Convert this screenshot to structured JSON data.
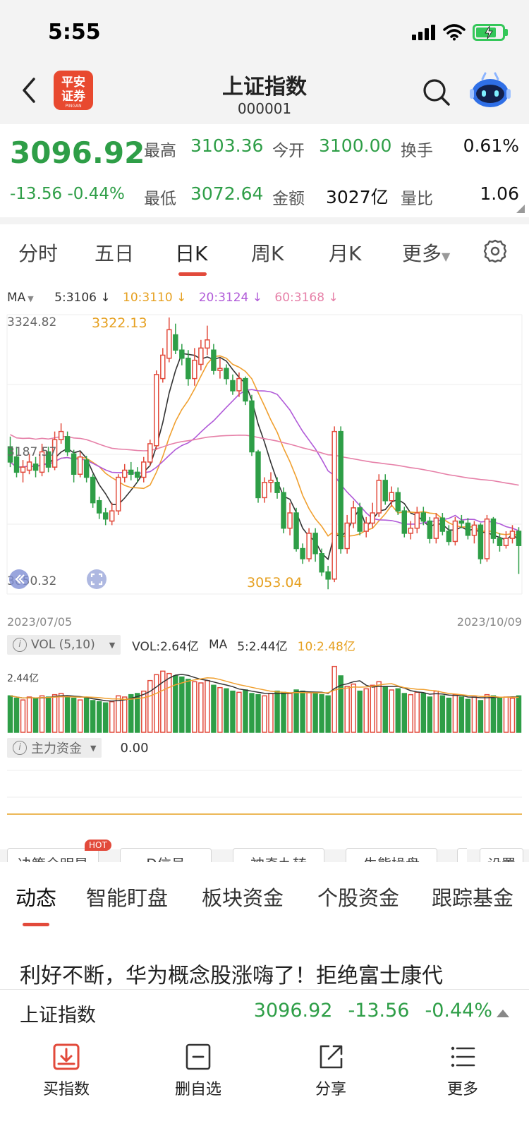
{
  "status_bar": {
    "time": "5:55"
  },
  "header": {
    "title": "上证指数",
    "code": "000001",
    "logo_text": "平安证券",
    "logo_sub": "PINGAN"
  },
  "quote": {
    "price": "3096.92",
    "change": "-13.56",
    "change_pct": "-0.44%",
    "high_label": "最高",
    "high": "3103.36",
    "open_label": "今开",
    "open": "3100.00",
    "turnover_label": "换手",
    "turnover": "0.61%",
    "low_label": "最低",
    "low": "3072.64",
    "amount_label": "金额",
    "amount": "3027亿",
    "vol_ratio_label": "量比",
    "vol_ratio": "1.06"
  },
  "tabs": [
    "分时",
    "五日",
    "日K",
    "周K",
    "月K",
    "更多"
  ],
  "active_tab": "日K",
  "ma_legend": {
    "label": "MA",
    "ma5": "5:3106 ↓",
    "ma10": "10:3110 ↓",
    "ma20": "20:3124 ↓",
    "ma60": "60:3168 ↓"
  },
  "axis": {
    "y_top": "3324.82",
    "y_mid": "3187.57",
    "y_bottom": "3050.32",
    "max_annot": "3322.13",
    "min_annot": "3053.04",
    "date_start": "2023/07/05",
    "date_end": "2023/10/09"
  },
  "volume": {
    "indicator": "VOL (5,10)",
    "vol": "VOL:2.64亿",
    "ma_label": "MA",
    "ma5": "5:2.44亿",
    "ma10": "10:2.48亿",
    "left_axis": "2.44亿"
  },
  "capital": {
    "label": "主力资金",
    "value": "0.00"
  },
  "tools": {
    "decision": "决策全明星",
    "hot": "HOT",
    "d_signal": "D信号",
    "nine": "神奇九转",
    "bull_bear": "牛熊操盘",
    "settings": "设置"
  },
  "news_tabs": [
    "动态",
    "智能盯盘",
    "板块资金",
    "个股资金",
    "跟踪基金"
  ],
  "headline": "利好不断，华为概念股涨嗨了！拒绝富士康代",
  "ticker": {
    "name": "上证指数",
    "price": "3096.92",
    "change": "-13.56",
    "pct": "-0.44%"
  },
  "actions": {
    "buy": "买指数",
    "remove": "删自选",
    "share": "分享",
    "more": "更多"
  },
  "colors": {
    "up": "#e24a3b",
    "down": "#2e9e47",
    "ma5": "#333333",
    "ma10": "#f0a030",
    "ma20": "#b05ad8",
    "ma60": "#e680a8"
  },
  "chart_data": {
    "type": "candlestick",
    "ylim": [
      3050.32,
      3324.82
    ],
    "x_start": "2023/07/05",
    "x_end": "2023/10/09",
    "candles": [
      [
        3195,
        3180,
        3205,
        3175
      ],
      [
        3185,
        3170,
        3195,
        3165
      ],
      [
        3170,
        3175,
        3182,
        3160
      ],
      [
        3172,
        3180,
        3188,
        3168
      ],
      [
        3178,
        3172,
        3185,
        3165
      ],
      [
        3170,
        3190,
        3198,
        3166
      ],
      [
        3190,
        3175,
        3195,
        3170
      ],
      [
        3175,
        3202,
        3210,
        3172
      ],
      [
        3202,
        3210,
        3218,
        3198
      ],
      [
        3205,
        3190,
        3210,
        3186
      ],
      [
        3188,
        3168,
        3192,
        3160
      ],
      [
        3168,
        3185,
        3190,
        3165
      ],
      [
        3182,
        3165,
        3186,
        3160
      ],
      [
        3165,
        3140,
        3168,
        3135
      ],
      [
        3142,
        3130,
        3146,
        3124
      ],
      [
        3130,
        3124,
        3135,
        3118
      ],
      [
        3122,
        3132,
        3140,
        3118
      ],
      [
        3132,
        3165,
        3168,
        3128
      ],
      [
        3165,
        3172,
        3178,
        3160
      ],
      [
        3172,
        3168,
        3180,
        3162
      ],
      [
        3170,
        3165,
        3175,
        3160
      ],
      [
        3165,
        3180,
        3185,
        3160
      ],
      [
        3180,
        3198,
        3202,
        3176
      ],
      [
        3196,
        3266,
        3270,
        3192
      ],
      [
        3262,
        3285,
        3292,
        3258
      ],
      [
        3282,
        3310,
        3322,
        3278
      ],
      [
        3305,
        3290,
        3316,
        3286
      ],
      [
        3290,
        3282,
        3296,
        3275
      ],
      [
        3282,
        3262,
        3290,
        3255
      ],
      [
        3262,
        3280,
        3292,
        3255
      ],
      [
        3276,
        3292,
        3300,
        3270
      ],
      [
        3292,
        3300,
        3314,
        3285
      ],
      [
        3290,
        3270,
        3296,
        3266
      ],
      [
        3270,
        3272,
        3282,
        3262
      ],
      [
        3272,
        3262,
        3276,
        3256
      ],
      [
        3260,
        3250,
        3266,
        3246
      ],
      [
        3250,
        3262,
        3268,
        3244
      ],
      [
        3262,
        3240,
        3264,
        3236
      ],
      [
        3240,
        3190,
        3246,
        3186
      ],
      [
        3190,
        3145,
        3192,
        3140
      ],
      [
        3145,
        3160,
        3165,
        3140
      ],
      [
        3160,
        3162,
        3170,
        3150
      ],
      [
        3160,
        3150,
        3165,
        3144
      ],
      [
        3150,
        3115,
        3155,
        3110
      ],
      [
        3115,
        3130,
        3140,
        3108
      ],
      [
        3130,
        3095,
        3135,
        3092
      ],
      [
        3095,
        3085,
        3100,
        3080
      ],
      [
        3085,
        3110,
        3115,
        3082
      ],
      [
        3110,
        3090,
        3115,
        3082
      ],
      [
        3090,
        3072,
        3095,
        3068
      ],
      [
        3072,
        3065,
        3078,
        3055
      ],
      [
        3065,
        3210,
        3215,
        3062
      ],
      [
        3210,
        3095,
        3215,
        3090
      ],
      [
        3095,
        3120,
        3128,
        3090
      ],
      [
        3120,
        3135,
        3142,
        3115
      ],
      [
        3135,
        3112,
        3140,
        3108
      ],
      [
        3112,
        3120,
        3126,
        3106
      ],
      [
        3120,
        3130,
        3140,
        3115
      ],
      [
        3130,
        3162,
        3168,
        3126
      ],
      [
        3162,
        3142,
        3168,
        3138
      ],
      [
        3142,
        3150,
        3156,
        3136
      ],
      [
        3150,
        3132,
        3155,
        3128
      ],
      [
        3132,
        3110,
        3136,
        3106
      ],
      [
        3110,
        3115,
        3122,
        3104
      ],
      [
        3115,
        3130,
        3136,
        3110
      ],
      [
        3130,
        3122,
        3136,
        3118
      ],
      [
        3122,
        3105,
        3126,
        3100
      ],
      [
        3105,
        3125,
        3130,
        3100
      ],
      [
        3125,
        3112,
        3130,
        3108
      ],
      [
        3112,
        3102,
        3118,
        3098
      ],
      [
        3102,
        3122,
        3126,
        3098
      ],
      [
        3122,
        3120,
        3128,
        3115
      ],
      [
        3120,
        3108,
        3125,
        3104
      ],
      [
        3108,
        3118,
        3122,
        3100
      ],
      [
        3118,
        3085,
        3120,
        3080
      ],
      [
        3085,
        3124,
        3128,
        3082
      ],
      [
        3124,
        3105,
        3126,
        3100
      ],
      [
        3105,
        3098,
        3110,
        3092
      ],
      [
        3098,
        3105,
        3112,
        3095
      ],
      [
        3105,
        3112,
        3118,
        3100
      ],
      [
        3112,
        3098,
        3116,
        3070
      ]
    ],
    "volumes": [
      62,
      58,
      55,
      60,
      58,
      62,
      60,
      64,
      66,
      60,
      58,
      55,
      58,
      54,
      52,
      50,
      52,
      62,
      60,
      64,
      66,
      70,
      88,
      98,
      104,
      100,
      96,
      94,
      90,
      86,
      84,
      88,
      80,
      76,
      74,
      70,
      68,
      72,
      66,
      64,
      62,
      66,
      70,
      68,
      66,
      72,
      70,
      68,
      66,
      64,
      62,
      112,
      96,
      78,
      82,
      70,
      74,
      80,
      86,
      78,
      72,
      74,
      66,
      64,
      68,
      66,
      60,
      70,
      62,
      58,
      64,
      60,
      56,
      60,
      54,
      64,
      62,
      58,
      60,
      58,
      62
    ]
  }
}
